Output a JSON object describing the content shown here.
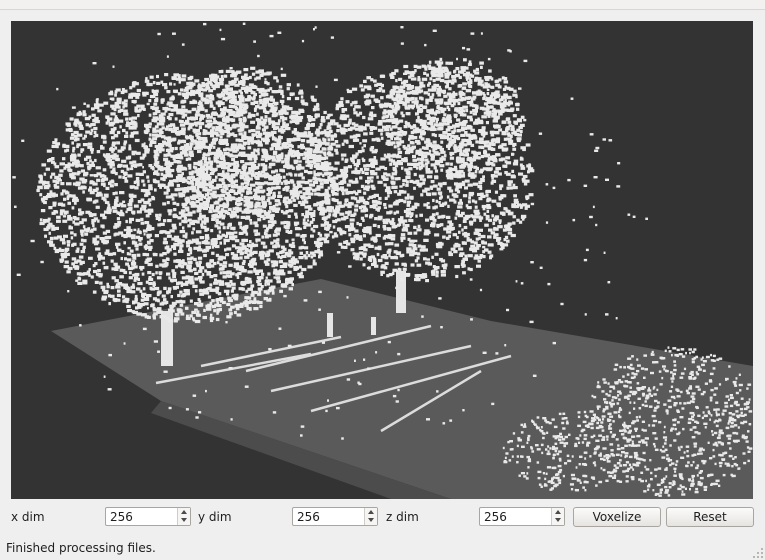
{
  "viewport": {
    "background": "#333333",
    "voxel_light": "#e9e9e9",
    "voxel_ground": "#595959"
  },
  "controls": {
    "x_dim": {
      "label": "x dim",
      "value": "256"
    },
    "y_dim": {
      "label": "y dim",
      "value": "256"
    },
    "z_dim": {
      "label": "z dim",
      "value": "256"
    },
    "voxelize_label": "Voxelize",
    "reset_label": "Reset"
  },
  "status": {
    "text": "Finished processing files."
  }
}
